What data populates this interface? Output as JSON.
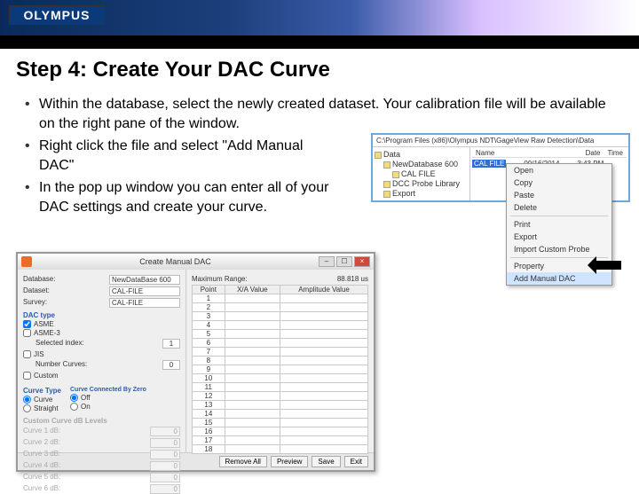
{
  "brand": "OLYMPUS",
  "title": "Step 4: Create Your DAC Curve",
  "bullets": [
    "Within the database, select the newly created dataset.  Your calibration file will be available on the right pane of the window.",
    "Right click the file and select \"Add Manual DAC\"",
    "In the pop up window you can enter all of your DAC settings and create your curve."
  ],
  "explorer": {
    "path": "C:\\Program Files (x86)\\Olympus NDT\\GageView Raw Detection\\Data",
    "tree": [
      "Data",
      "NewDatabase 600",
      "CAL FILE",
      "DCC Probe Library",
      "Export"
    ],
    "columns": [
      "Name",
      "Date",
      "Time"
    ],
    "file": {
      "name": "CAL FILE",
      "date": "09/16/2014",
      "time": "3:43 PM"
    },
    "context_menu": [
      "Open",
      "Copy",
      "Paste",
      "Delete",
      "__sep__",
      "Print",
      "Export",
      "Import Custom Probe",
      "__sep__",
      "Property",
      "Add Manual DAC"
    ]
  },
  "dialog": {
    "title": "Create Manual DAC",
    "fields": {
      "database_label": "Database:",
      "database": "NewDataBase 600",
      "dataset_label": "Dataset:",
      "dataset": "CAL-FILE",
      "survey_label": "Survey:",
      "survey": "CAL-FILE",
      "max_range_label": "Maximum Range:",
      "max_range": "88.818 us"
    },
    "dac_type": {
      "heading": "DAC type",
      "options": [
        "ASME",
        "ASME-3",
        "JIS",
        "Custom"
      ]
    },
    "sel_index_label": "Selected index:",
    "sel_index": "1",
    "num_curves_label": "Number Curves:",
    "num_curves": "0",
    "curve_type": {
      "heading": "Curve Type",
      "options": [
        "Curve",
        "Straight"
      ]
    },
    "connected": {
      "heading": "Curve Connected By Zero",
      "options": [
        "Off",
        "On"
      ]
    },
    "levels_heading": "Custom Curve dB Levels",
    "levels": [
      "Curve 1 dB:",
      "Curve 2 dB:",
      "Curve 3 dB:",
      "Curve 4 dB:",
      "Curve 5 dB:",
      "Curve 6 dB:"
    ],
    "level_val": "0",
    "table": {
      "headers": [
        "Point",
        "X/A Value",
        "Amplitude Value"
      ],
      "rows": 18
    },
    "buttons": [
      "Remove All",
      "Preview",
      "Save",
      "Exit"
    ]
  }
}
